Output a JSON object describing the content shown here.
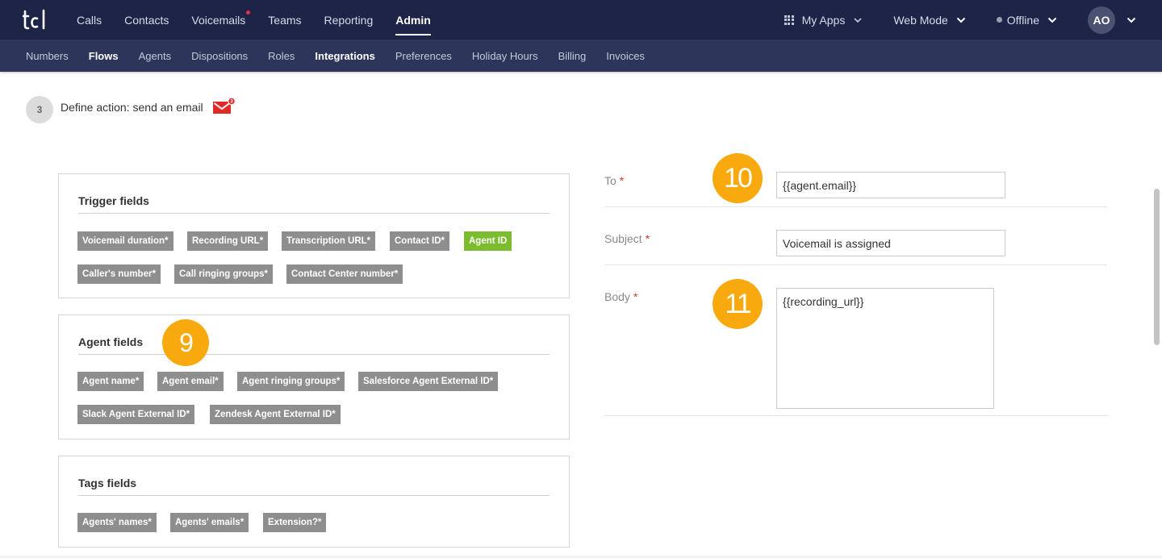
{
  "topnav": {
    "items": [
      {
        "label": "Calls"
      },
      {
        "label": "Contacts"
      },
      {
        "label": "Voicemails"
      },
      {
        "label": "Teams"
      },
      {
        "label": "Reporting"
      },
      {
        "label": "Admin"
      }
    ],
    "my_apps": "My Apps",
    "web_mode": "Web Mode",
    "status": "Offline",
    "avatar": "AO"
  },
  "subnav": {
    "items": [
      {
        "label": "Numbers"
      },
      {
        "label": "Flows"
      },
      {
        "label": "Agents"
      },
      {
        "label": "Dispositions"
      },
      {
        "label": "Roles"
      },
      {
        "label": "Integrations"
      },
      {
        "label": "Preferences"
      },
      {
        "label": "Holiday Hours"
      },
      {
        "label": "Billing"
      },
      {
        "label": "Invoices"
      }
    ]
  },
  "step": {
    "number": "3",
    "title": "Define action: send an email",
    "mail_badge": "3"
  },
  "trigger_fields": {
    "title": "Trigger fields",
    "tags": [
      "Voicemail duration*",
      "Recording URL*",
      "Transcription URL*",
      "Contact ID*",
      "Agent ID",
      "Caller's number*",
      "Call ringing groups*",
      "Contact Center number*"
    ]
  },
  "agent_fields": {
    "title": "Agent fields",
    "tags": [
      "Agent name*",
      "Agent email*",
      "Agent ringing groups*",
      "Salesforce Agent External ID*",
      "Slack Agent External ID*",
      "Zendesk Agent External ID*"
    ]
  },
  "tags_fields": {
    "title": "Tags fields",
    "tags": [
      "Agents' names*",
      "Agents' emails*",
      "Extension?*"
    ]
  },
  "badges": {
    "nine": "9",
    "ten": "10",
    "eleven": "11"
  },
  "form": {
    "to_label": "To",
    "to_value": "{{agent.email}}",
    "subject_label": "Subject",
    "subject_value": "Voicemail is assigned",
    "body_label": "Body",
    "body_value": "{{recording_url}}",
    "required_mark": "*"
  },
  "colors": {
    "navy": "#1d2448",
    "subnav": "#2d365a",
    "tag_gray": "#8e8e8e",
    "tag_green": "#7cbd2f",
    "badge_orange": "#f7a90e",
    "required_red": "#d43b3b"
  },
  "icons": [
    "tcl-logo-icon",
    "grid-icon",
    "chevron-down-icon",
    "mail-icon"
  ]
}
